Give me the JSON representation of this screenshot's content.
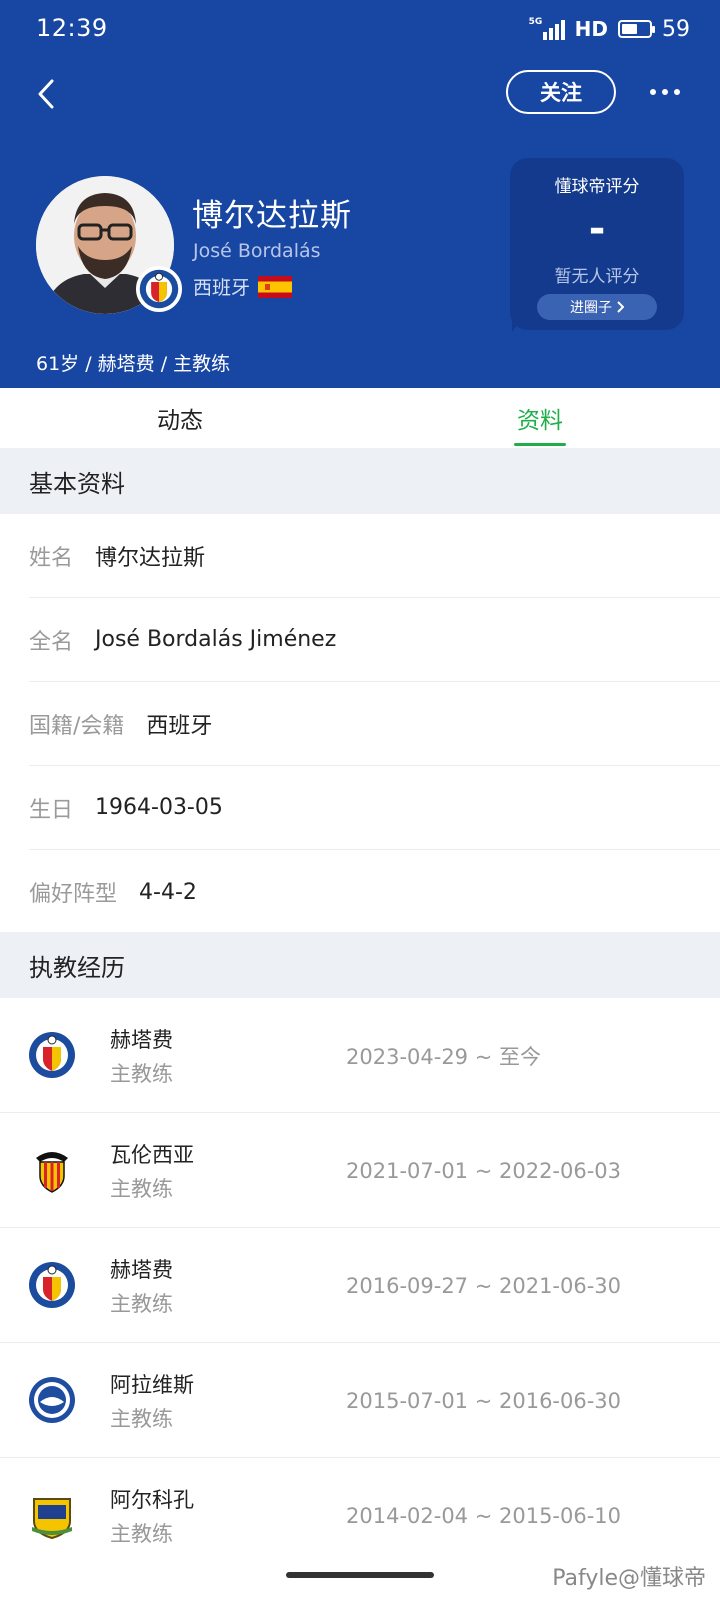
{
  "status_bar": {
    "time": "12:39",
    "network": "5G",
    "hd": "HD",
    "battery": "59",
    "battery_level": 0.59
  },
  "header": {
    "follow_label": "关注",
    "name_cn": "博尔达拉斯",
    "name_en": "José Bordalás",
    "nationality": "西班牙",
    "meta": "61岁 / 赫塔费 / 主教练",
    "rating": {
      "title": "懂球帝评分",
      "value": "-",
      "no_rating": "暂无人评分",
      "circle_button": "进圈子"
    }
  },
  "tabs": [
    {
      "label": "动态",
      "active": false
    },
    {
      "label": "资料",
      "active": true
    }
  ],
  "basic_info": {
    "title": "基本资料",
    "rows": [
      {
        "label": "姓名",
        "value": "博尔达拉斯"
      },
      {
        "label": "全名",
        "value": "José Bordalás Jiménez"
      },
      {
        "label": "国籍/会籍",
        "value": "西班牙"
      },
      {
        "label": "生日",
        "value": "1964-03-05"
      },
      {
        "label": "偏好阵型",
        "value": "4-4-2"
      }
    ]
  },
  "career": {
    "title": "执教经历",
    "rows": [
      {
        "club": "赫塔费",
        "role": "主教练",
        "dates": "2023-04-29 ~ 至今",
        "logo": "getafe-logo"
      },
      {
        "club": "瓦伦西亚",
        "role": "主教练",
        "dates": "2021-07-01 ~ 2022-06-03",
        "logo": "valencia-logo"
      },
      {
        "club": "赫塔费",
        "role": "主教练",
        "dates": "2016-09-27 ~ 2021-06-30",
        "logo": "getafe-logo"
      },
      {
        "club": "阿拉维斯",
        "role": "主教练",
        "dates": "2015-07-01 ~ 2016-06-30",
        "logo": "alaves-logo"
      },
      {
        "club": "阿尔科孔",
        "role": "主教练",
        "dates": "2014-02-04 ~ 2015-06-10",
        "logo": "alcorcon-logo"
      }
    ]
  },
  "watermark": "Pafyle@懂球帝",
  "colors": {
    "header_bg": "#1846a3",
    "rating_bg": "#133a8c",
    "accent_green": "#1fae4a",
    "section_bg": "#edf0f4"
  }
}
